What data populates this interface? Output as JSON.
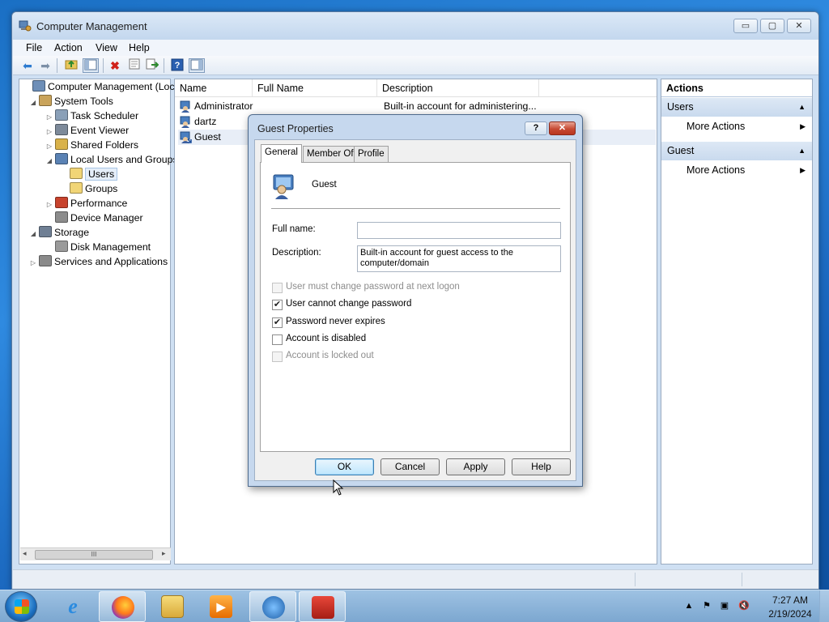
{
  "window": {
    "title": "Computer Management",
    "controls": {
      "minimize": "▭",
      "maximize": "▢",
      "close": "✕"
    }
  },
  "menu": {
    "file": "File",
    "action": "Action",
    "view": "View",
    "help": "Help"
  },
  "toolbar_icons": [
    "back-icon",
    "forward-icon",
    "up-folder-icon",
    "show-hide-tree-icon",
    "delete-icon",
    "properties-icon",
    "export-icon",
    "help-icon",
    "show-hide-action-pane-icon"
  ],
  "tree": {
    "items": [
      {
        "label": "Computer Management (Local",
        "icon": "computer-management-icon",
        "level": 0,
        "expander": ""
      },
      {
        "label": "System Tools",
        "icon": "system-tools-icon",
        "level": 1,
        "expander": "◢"
      },
      {
        "label": "Task Scheduler",
        "icon": "task-scheduler-icon",
        "level": 2,
        "expander": "▷"
      },
      {
        "label": "Event Viewer",
        "icon": "event-viewer-icon",
        "level": 2,
        "expander": "▷"
      },
      {
        "label": "Shared Folders",
        "icon": "shared-folders-icon",
        "level": 2,
        "expander": "▷"
      },
      {
        "label": "Local Users and Groups",
        "icon": "local-users-groups-icon",
        "level": 2,
        "expander": "◢"
      },
      {
        "label": "Users",
        "icon": "folder-icon",
        "level": 3,
        "expander": ""
      },
      {
        "label": "Groups",
        "icon": "folder-icon",
        "level": 3,
        "expander": ""
      },
      {
        "label": "Performance",
        "icon": "performance-icon",
        "level": 2,
        "expander": "▷"
      },
      {
        "label": "Device Manager",
        "icon": "device-manager-icon",
        "level": 2,
        "expander": ""
      },
      {
        "label": "Storage",
        "icon": "storage-icon",
        "level": 1,
        "expander": "◢"
      },
      {
        "label": "Disk Management",
        "icon": "disk-management-icon",
        "level": 2,
        "expander": ""
      },
      {
        "label": "Services and Applications",
        "icon": "services-applications-icon",
        "level": 1,
        "expander": "▷"
      }
    ],
    "scroll_thumb": "III",
    "scroll_left": "◂",
    "scroll_right": "▸"
  },
  "list": {
    "columns": {
      "name": "Name",
      "full_name": "Full Name",
      "description": "Description"
    },
    "rows": [
      {
        "name": "Administrator",
        "full_name": "",
        "description": "Built-in account for administering..."
      },
      {
        "name": "dartz",
        "full_name": "",
        "description": ""
      },
      {
        "name": "Guest",
        "full_name": "",
        "description": ""
      }
    ]
  },
  "actions": {
    "title": "Actions",
    "groups": [
      {
        "label": "Users",
        "item": "More Actions"
      },
      {
        "label": "Guest",
        "item": "More Actions"
      }
    ]
  },
  "dialog": {
    "title": "Guest Properties",
    "help_btn": "?",
    "close_btn": "✕",
    "tabs": {
      "general": "General",
      "member_of": "Member Of",
      "profile": "Profile"
    },
    "user_name": "Guest",
    "full_name_label": "Full name:",
    "full_name_value": "",
    "description_label": "Description:",
    "description_value": "Built-in account for guest access to the computer/domain",
    "checkboxes": [
      {
        "label": "User must change password at next logon",
        "checked": false,
        "disabled": true
      },
      {
        "label": "User cannot change password",
        "checked": true,
        "disabled": false
      },
      {
        "label": "Password never expires",
        "checked": true,
        "disabled": false
      },
      {
        "label": "Account is disabled",
        "checked": false,
        "disabled": false
      },
      {
        "label": "Account is locked out",
        "checked": false,
        "disabled": true
      }
    ],
    "buttons": {
      "ok": "OK",
      "cancel": "Cancel",
      "apply": "Apply",
      "help": "Help"
    }
  },
  "taskbar": {
    "apps": [
      "internet-explorer-icon",
      "firefox-icon",
      "file-explorer-icon",
      "media-player-icon",
      "network-setup-icon",
      "toolbox-app-icon"
    ],
    "clock_time": "7:27 AM",
    "clock_date": "2/19/2024"
  },
  "colors": {
    "titlebar": "#c3d7ee",
    "action_group": "#c9daee",
    "selected_row": "#e8eef7",
    "desktop": "#1a6fc4",
    "close_red": "#c74a33"
  }
}
